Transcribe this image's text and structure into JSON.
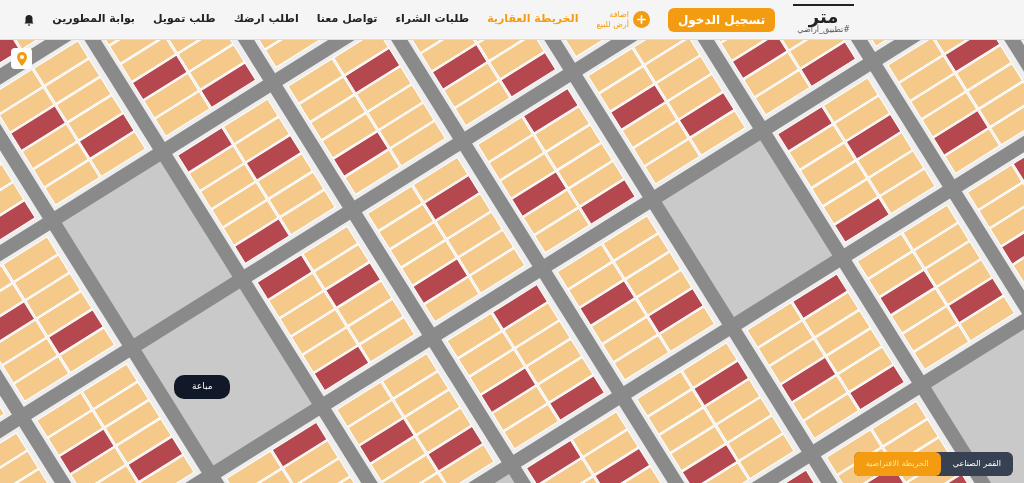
{
  "header": {
    "logo": {
      "text": "متر",
      "tagline": "#تطبيق_أراضي"
    },
    "login_button": "تسجيل الدخول",
    "add_land": {
      "line_1": "اضافة",
      "line_2": "أرض للبيع"
    },
    "nav": [
      {
        "label": "الخريطة العقارية",
        "selected": true
      },
      {
        "label": "طلبات الشراء",
        "selected": false
      },
      {
        "label": "تواصل معنا",
        "selected": false
      },
      {
        "label": "اطلب ارضك",
        "selected": false
      },
      {
        "label": "طلب تمويل",
        "selected": false
      },
      {
        "label": "بوابة المطورين",
        "selected": false
      }
    ]
  },
  "map": {
    "tooltip": "مباعة",
    "layer_toggle": [
      {
        "label": "القمر الصناعي",
        "selected": false
      },
      {
        "label": "الخريطة الافتراضية",
        "selected": true
      }
    ]
  }
}
